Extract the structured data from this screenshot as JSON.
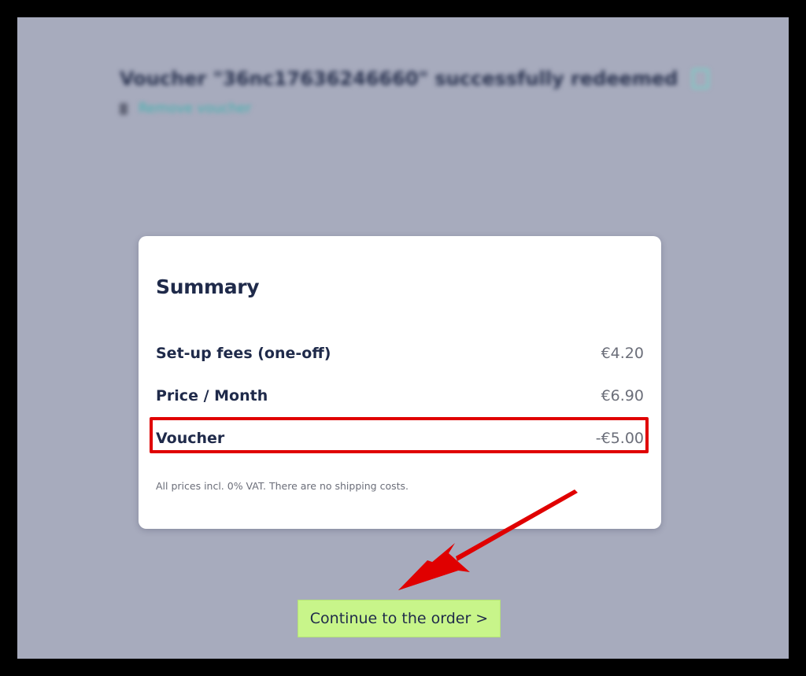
{
  "background": {
    "voucher_heading": "Voucher \"36nc17636246660\" successfully redeemed",
    "remove_voucher_label": "Remove voucher"
  },
  "summary": {
    "title": "Summary",
    "rows": [
      {
        "label": "Set-up fees (one-off)",
        "value": "€4.20"
      },
      {
        "label": "Price / Month",
        "value": "€6.90"
      },
      {
        "label": "Voucher",
        "value": "-€5.00"
      }
    ],
    "vat_note": "All prices incl. 0% VAT. There are no shipping costs."
  },
  "continue_button": {
    "label": "Continue to the order >"
  },
  "colors": {
    "overlay": "#a7abbd",
    "highlight": "#e00000",
    "button": "#c8f58a",
    "text_dark": "#1f2a4a"
  },
  "icons": {
    "copy": "copy-icon",
    "trash": "trash-icon",
    "arrow": "arrow-annotation-icon"
  }
}
